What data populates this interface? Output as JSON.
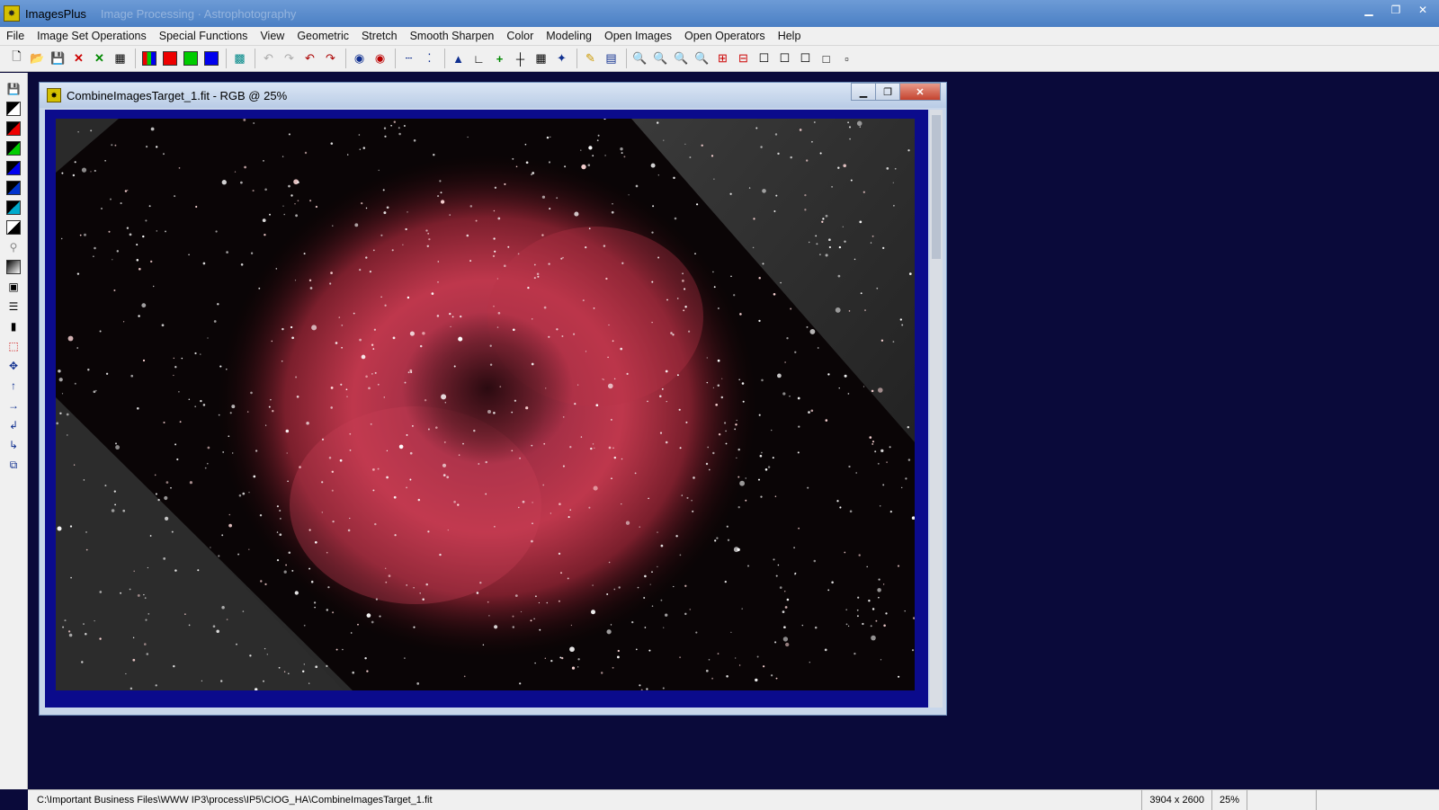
{
  "app": {
    "title": "ImagesPlus",
    "title_ghost": "Image Processing · Astrophotography"
  },
  "menu": [
    "File",
    "Image Set Operations",
    "Special Functions",
    "View",
    "Geometric",
    "Stretch",
    "Smooth Sharpen",
    "Color",
    "Modeling",
    "Open Images",
    "Open Operators",
    "Help"
  ],
  "child_window": {
    "title": "CombineImagesTarget_1.fit - RGB @ 25%"
  },
  "status": {
    "path": "C:\\Important Business Files\\WWW IP3\\process\\IP5\\CIOG_HA\\CombineImagesTarget_1.fit",
    "dimensions": "3904 x 2600",
    "zoom": "25%"
  },
  "colors": {
    "workspace": "#0a0a3a",
    "frame": "#0b0b8c",
    "nebula": "#c83a50"
  },
  "toolbar_icons": [
    "new-icon",
    "open-icon",
    "save-icon",
    "close-icon",
    "close-all-icon",
    "print-icon",
    "rgb-icon",
    "red-icon",
    "green-icon",
    "blue-icon",
    "image-icon",
    "undo-disabled-icon",
    "redo-disabled-icon",
    "undo-icon",
    "redo-icon",
    "circle-icon",
    "circle-red-icon",
    "dots-icon",
    "point-icon",
    "histogram-icon",
    "axis-icon",
    "plus-green-icon",
    "crosshair-icon",
    "grid-icon",
    "paint-icon",
    "pencil-icon",
    "fill-icon",
    "zoom-in-icon",
    "zoom-out-icon",
    "zoom-fit-icon",
    "zoom-reset-icon",
    "add-icon",
    "subtract-icon",
    "frame1-icon",
    "frame2-icon",
    "frame3-icon",
    "frame4-icon",
    "frame5-icon"
  ],
  "leftbar_icons": [
    "save-icon",
    "bw-icon",
    "red-icon",
    "green-icon",
    "blue-icon",
    "black-icon",
    "cyan-icon",
    "white-icon",
    "link-icon",
    "gradient-icon",
    "select-icon",
    "lines-icon",
    "black-box-icon",
    "cursor-icon",
    "move-icon",
    "arrow-up-icon",
    "arrow-right-icon",
    "rotate-left-icon",
    "rotate-right-icon",
    "copy-icon"
  ]
}
